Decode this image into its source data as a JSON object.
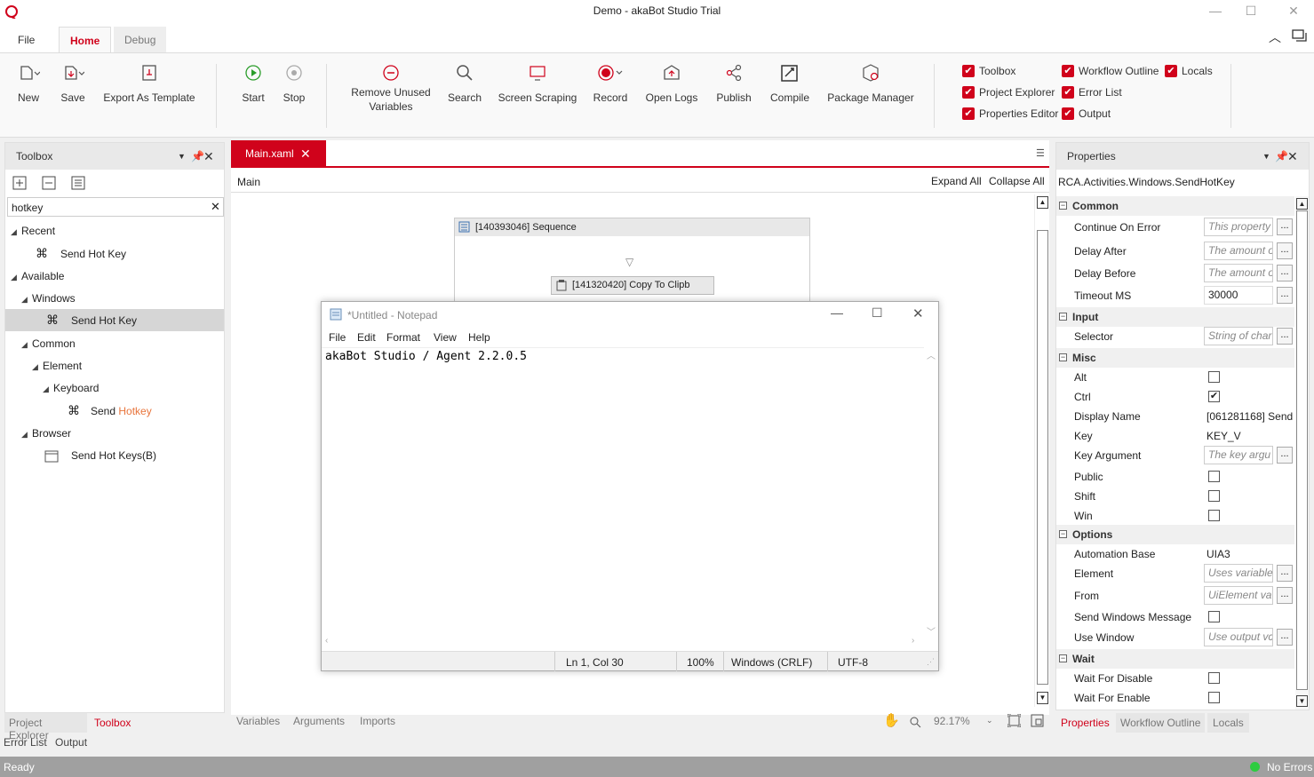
{
  "window": {
    "title": "Demo - akaBot Studio Trial"
  },
  "menu_tabs": {
    "file": "File",
    "home": "Home",
    "debug": "Debug"
  },
  "ribbon": {
    "new": "New",
    "save": "Save",
    "export_template": "Export As Template",
    "start": "Start",
    "stop": "Stop",
    "remove_unused_1": "Remove Unused",
    "remove_unused_2": "Variables",
    "search": "Search",
    "screen_scraping": "Screen Scraping",
    "record": "Record",
    "open_logs": "Open Logs",
    "publish": "Publish",
    "compile": "Compile",
    "package_manager": "Package Manager",
    "checks": {
      "toolbox": "Toolbox",
      "project_explorer": "Project Explorer",
      "properties_editor": "Properties Editor",
      "workflow_outline": "Workflow Outline",
      "error_list": "Error List",
      "output": "Output",
      "locals": "Locals"
    }
  },
  "toolbox": {
    "title": "Toolbox",
    "search_value": "hotkey",
    "items": {
      "recent": "Recent",
      "recent_send": "Send Hot Key",
      "available": "Available",
      "windows": "Windows",
      "windows_send": "Send Hot Key",
      "common": "Common",
      "element": "Element",
      "keyboard": "Keyboard",
      "send_prefix": "Send ",
      "send_hl": "Hotkey",
      "browser": "Browser",
      "browser_send": "Send Hot Keys(B)"
    },
    "bottom_tabs": {
      "project_explorer": "Project Explorer",
      "toolbox": "Toolbox",
      "error_list": "Error List",
      "output": "Output"
    }
  },
  "designer": {
    "tab": "Main.xaml",
    "breadcrumb": "Main",
    "expand_all": "Expand All",
    "collapse_all": "Collapse All",
    "sequence_label": "[140393046] Sequence",
    "copy_label": "[141320420] Copy To Clipb",
    "bottom_tabs": {
      "variables": "Variables",
      "arguments": "Arguments",
      "imports": "Imports"
    },
    "zoom": "92.17%"
  },
  "notepad": {
    "title": "*Untitled - Notepad",
    "menu": {
      "file": "File",
      "edit": "Edit",
      "format": "Format",
      "view": "View",
      "help": "Help"
    },
    "content": "akaBot Studio / Agent 2.2.0.5",
    "status": {
      "pos": "Ln 1, Col 30",
      "zoom": "100%",
      "eol": "Windows (CRLF)",
      "enc": "UTF-8"
    }
  },
  "properties": {
    "title": "Properties",
    "type": "RCA.Activities.Windows.SendHotKey",
    "sections": {
      "common": "Common",
      "input": "Input",
      "misc": "Misc",
      "options": "Options",
      "wait": "Wait"
    },
    "rows": {
      "continue_on_error": {
        "k": "Continue On Error",
        "v": "This property"
      },
      "delay_after": {
        "k": "Delay After",
        "v": "The amount o"
      },
      "delay_before": {
        "k": "Delay Before",
        "v": "The amount o"
      },
      "timeout": {
        "k": "Timeout MS",
        "v": "30000"
      },
      "selector": {
        "k": "Selector",
        "v": "String of char"
      },
      "alt": {
        "k": "Alt"
      },
      "ctrl": {
        "k": "Ctrl",
        "checked": "✔"
      },
      "display_name": {
        "k": "Display Name",
        "v": "[061281168] Send"
      },
      "key": {
        "k": "Key",
        "v": "KEY_V"
      },
      "key_argument": {
        "k": "Key Argument",
        "v": "The key argu"
      },
      "public": {
        "k": "Public"
      },
      "shift": {
        "k": "Shift"
      },
      "win": {
        "k": "Win"
      },
      "automation_base": {
        "k": "Automation Base",
        "v": "UIA3"
      },
      "element": {
        "k": "Element",
        "v": "Uses variable"
      },
      "from": {
        "k": "From",
        "v": "UiElement va"
      },
      "send_windows_message": {
        "k": "Send Windows Message"
      },
      "use_window": {
        "k": "Use Window",
        "v": "Use output vc"
      },
      "wait_disable": {
        "k": "Wait For Disable"
      },
      "wait_enable": {
        "k": "Wait For Enable"
      }
    },
    "bottom_tabs": {
      "properties": "Properties",
      "workflow_outline": "Workflow Outline",
      "locals": "Locals"
    }
  },
  "status": {
    "left": "Ready",
    "right": "No Errors"
  },
  "colors": {
    "accent": "#d0021b",
    "status_ok": "#2ecc40"
  }
}
